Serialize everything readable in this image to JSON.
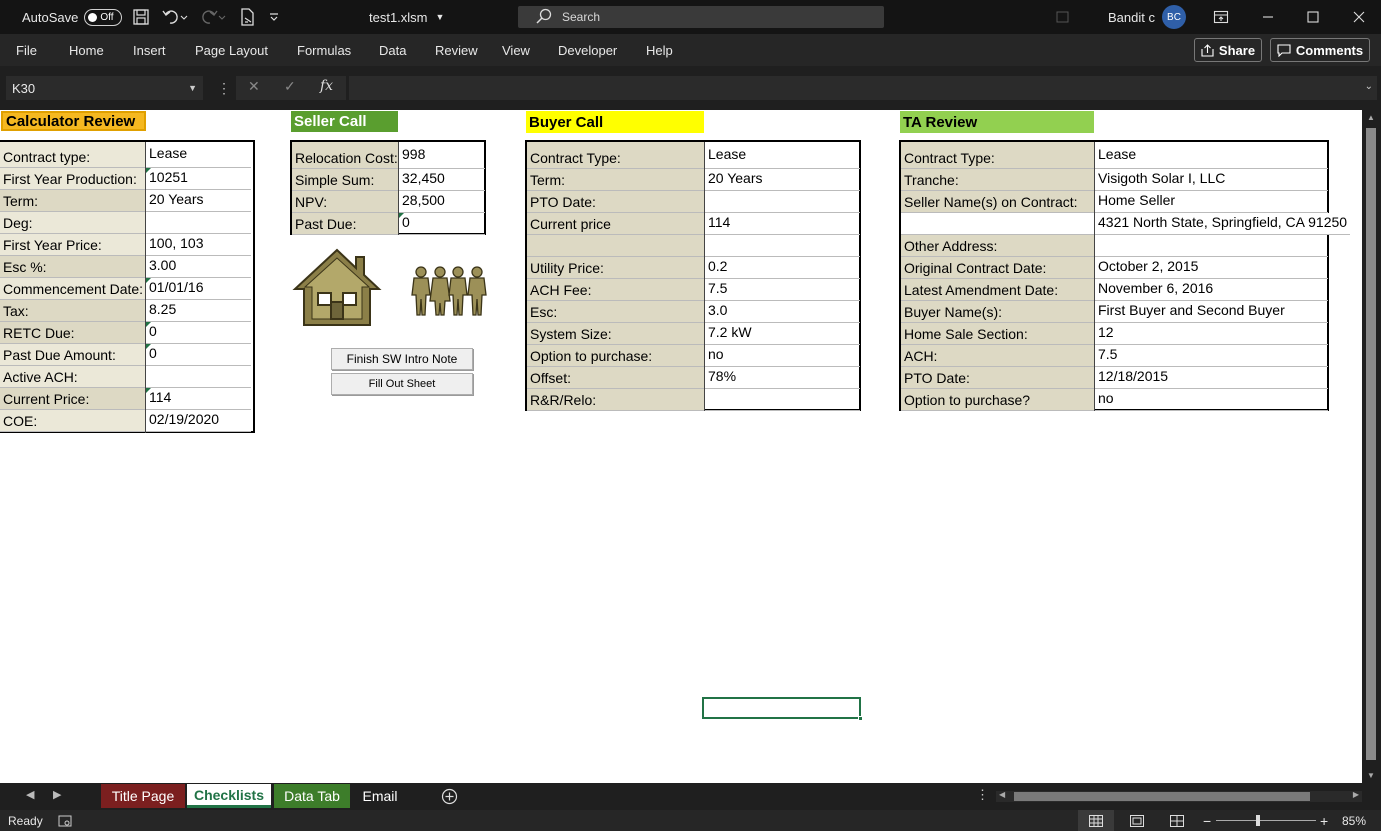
{
  "titlebar": {
    "autosave_label": "AutoSave",
    "autosave_state": "Off",
    "filename": "test1.xlsm",
    "search_placeholder": "Search",
    "user_name": "Bandit c",
    "user_initials": "BC"
  },
  "menu": {
    "items": [
      "File",
      "Home",
      "Insert",
      "Page Layout",
      "Formulas",
      "Data",
      "Review",
      "View",
      "Developer",
      "Help"
    ],
    "share_label": "Share",
    "comments_label": "Comments"
  },
  "formula_bar": {
    "name_box": "K30",
    "formula": ""
  },
  "sections": {
    "calculator": {
      "title": "Calculator Review",
      "rows": [
        {
          "label": "Contract type:",
          "value": "Lease"
        },
        {
          "label": "First Year Production:",
          "value": "10251"
        },
        {
          "label": "Term:",
          "value": "20 Years"
        },
        {
          "label": "Deg:",
          "value": ""
        },
        {
          "label": "First Year Price:",
          "value": "100, 103"
        },
        {
          "label": "Esc %:",
          "value": "3.00"
        },
        {
          "label": "Commencement Date:",
          "value": "01/01/16"
        },
        {
          "label": "Tax:",
          "value": "8.25"
        },
        {
          "label": "RETC Due:",
          "value": "0"
        },
        {
          "label": "Past Due Amount:",
          "value": "0"
        },
        {
          "label": "Active ACH:",
          "value": ""
        },
        {
          "label": "Current Price:",
          "value": "114"
        },
        {
          "label": "COE:",
          "value": "02/19/2020"
        }
      ]
    },
    "seller": {
      "title": "Seller Call",
      "rows": [
        {
          "label": "Relocation Cost:",
          "value": "998"
        },
        {
          "label": "Simple Sum:",
          "value": "32,450"
        },
        {
          "label": "NPV:",
          "value": "28,500"
        },
        {
          "label": "Past Due:",
          "value": "0"
        }
      ]
    },
    "buyer": {
      "title": "Buyer Call",
      "rows": [
        {
          "label": "Contract Type:",
          "value": "Lease"
        },
        {
          "label": "Term:",
          "value": "20 Years"
        },
        {
          "label": "PTO Date:",
          "value": ""
        },
        {
          "label": "Current price",
          "value": "114"
        },
        {
          "label": "",
          "value": ""
        },
        {
          "label": "Utility Price:",
          "value": "0.2"
        },
        {
          "label": "ACH Fee:",
          "value": "7.5"
        },
        {
          "label": "Esc:",
          "value": "3.0"
        },
        {
          "label": "System Size:",
          "value": "7.2 kW"
        },
        {
          "label": "Option to purchase:",
          "value": "no"
        },
        {
          "label": "Offset:",
          "value": "78%"
        },
        {
          "label": "R&R/Relo:",
          "value": ""
        }
      ]
    },
    "ta": {
      "title": "TA Review",
      "rows": [
        {
          "label": "Contract Type:",
          "value": "Lease"
        },
        {
          "label": "Tranche:",
          "value": "Visigoth Solar I, LLC"
        },
        {
          "label": "Seller Name(s) on Contract:",
          "value": "Home Seller"
        },
        {
          "label": "",
          "value": "4321 North State, Springfield, CA 91250"
        },
        {
          "label": "Other Address:",
          "value": ""
        },
        {
          "label": "Original Contract Date:",
          "value": "October 2, 2015"
        },
        {
          "label": "Latest Amendment Date:",
          "value": "November 6, 2016"
        },
        {
          "label": "Buyer Name(s):",
          "value": "First Buyer and Second Buyer"
        },
        {
          "label": "Home Sale Section:",
          "value": "12"
        },
        {
          "label": "ACH:",
          "value": "7.5"
        },
        {
          "label": "PTO Date:",
          "value": "12/18/2015"
        },
        {
          "label": "Option to purchase?",
          "value": "no"
        }
      ]
    }
  },
  "buttons": {
    "finish_note": "Finish SW Intro Note",
    "fill_sheet": "Fill Out Sheet"
  },
  "sheet_tabs": [
    {
      "label": "Title Page",
      "color": "#7b1f1f"
    },
    {
      "label": "Checklists",
      "color": "#ffffff"
    },
    {
      "label": "Data Tab",
      "color": "#3d7d2a"
    },
    {
      "label": "Email",
      "color": ""
    }
  ],
  "status": {
    "ready": "Ready",
    "zoom": "85%"
  },
  "colors": {
    "calculator_header": "#f5b820",
    "seller_header": "#5a9e2f",
    "buyer_header": "#ffff00",
    "ta_header": "#92d050",
    "label_fill": "#ddd9c4",
    "excel_green": "#217346"
  }
}
